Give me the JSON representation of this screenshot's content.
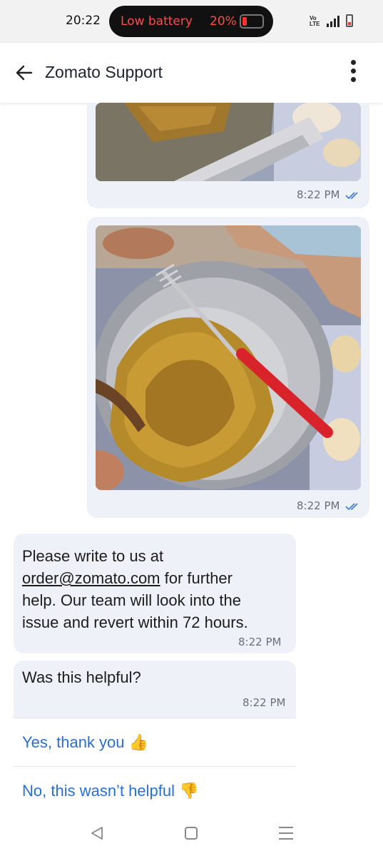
{
  "status_bar": {
    "time": "20:22",
    "low_battery_label": "Low battery",
    "battery_percent": "20%",
    "network_label": "Vo LTE"
  },
  "header": {
    "title": "Zomato Support"
  },
  "messages": [
    {
      "type": "image",
      "side": "right",
      "time": "8:22 PM",
      "read": true
    },
    {
      "type": "image",
      "side": "right",
      "time": "8:22 PM",
      "read": true
    },
    {
      "type": "text",
      "side": "left",
      "email": "order@zomato.com",
      "line1": "Please write to us at",
      "line2_suffix": " for further",
      "line3": "help. Our team will look into the",
      "line4": "issue and revert within 72 hours.",
      "time": "8:22 PM"
    },
    {
      "type": "feedback",
      "side": "left",
      "question": "Was this helpful?",
      "time": "8:22 PM",
      "options": [
        "Yes, thank you 👍",
        "No, this wasn’t helpful 👎"
      ]
    }
  ],
  "colors": {
    "bubble": "#eef1f7",
    "option_text": "#2a6fd6",
    "read_tick": "#3a78d8",
    "battery_warning": "#ff4a4a"
  }
}
